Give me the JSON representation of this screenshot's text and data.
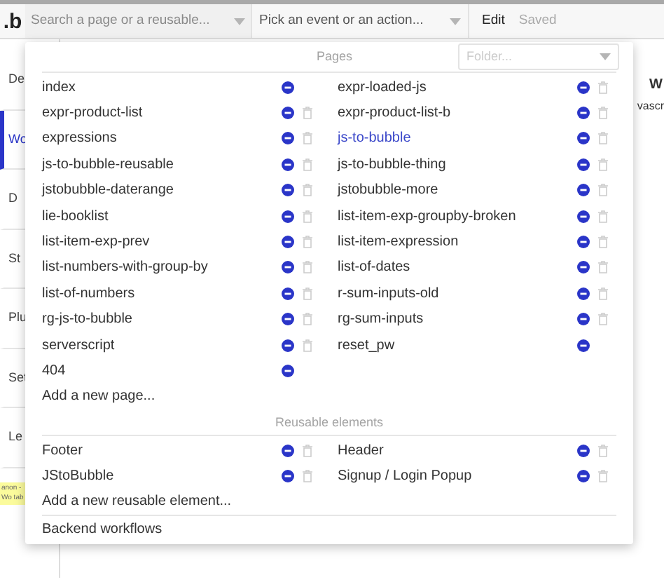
{
  "toolbar": {
    "logo": ".b",
    "page_search": {
      "placeholder": "Search a page or a reusable..."
    },
    "event_picker": {
      "placeholder": "Pick an event or an action..."
    },
    "mode": "Edit",
    "save_status": "Saved"
  },
  "sidebar": {
    "items": [
      {
        "label": "De",
        "selected": false
      },
      {
        "label": "Wo",
        "selected": true
      },
      {
        "label": "D",
        "selected": false
      },
      {
        "label": "St",
        "selected": false
      },
      {
        "label": "Plu",
        "selected": false
      },
      {
        "label": "Set",
        "selected": false
      },
      {
        "label": "Le",
        "selected": false
      }
    ],
    "note": "anon - Wo tab"
  },
  "background": {
    "heading": "W",
    "text": "vascr"
  },
  "dropdown": {
    "pages_heading": "Pages",
    "folder": {
      "placeholder": "Folder..."
    },
    "pages": [
      {
        "name": "index",
        "selected": false,
        "deletable": false
      },
      {
        "name": "expr-loaded-js",
        "selected": false,
        "deletable": true
      },
      {
        "name": "expr-product-list",
        "selected": false,
        "deletable": true
      },
      {
        "name": "expr-product-list-b",
        "selected": false,
        "deletable": true
      },
      {
        "name": "expressions",
        "selected": false,
        "deletable": true
      },
      {
        "name": "js-to-bubble",
        "selected": true,
        "deletable": true
      },
      {
        "name": "js-to-bubble-reusable",
        "selected": false,
        "deletable": true
      },
      {
        "name": "js-to-bubble-thing",
        "selected": false,
        "deletable": true
      },
      {
        "name": "jstobubble-daterange",
        "selected": false,
        "deletable": true
      },
      {
        "name": "jstobubble-more",
        "selected": false,
        "deletable": true
      },
      {
        "name": "lie-booklist",
        "selected": false,
        "deletable": true
      },
      {
        "name": "list-item-exp-groupby-broken",
        "selected": false,
        "deletable": true
      },
      {
        "name": "list-item-exp-prev",
        "selected": false,
        "deletable": true
      },
      {
        "name": "list-item-expression",
        "selected": false,
        "deletable": true
      },
      {
        "name": "list-numbers-with-group-by",
        "selected": false,
        "deletable": true
      },
      {
        "name": "list-of-dates",
        "selected": false,
        "deletable": true
      },
      {
        "name": "list-of-numbers",
        "selected": false,
        "deletable": true
      },
      {
        "name": "r-sum-inputs-old",
        "selected": false,
        "deletable": true
      },
      {
        "name": "rg-js-to-bubble",
        "selected": false,
        "deletable": true
      },
      {
        "name": "rg-sum-inputs",
        "selected": false,
        "deletable": true
      },
      {
        "name": "serverscript",
        "selected": false,
        "deletable": true
      },
      {
        "name": "reset_pw",
        "selected": false,
        "deletable": false
      },
      {
        "name": "404",
        "selected": false,
        "deletable": false
      }
    ],
    "add_page": "Add a new page...",
    "reusables_heading": "Reusable elements",
    "reusables": [
      {
        "name": "Footer",
        "selected": false,
        "deletable": true
      },
      {
        "name": "Header",
        "selected": false,
        "deletable": true
      },
      {
        "name": "JStoBubble",
        "selected": false,
        "deletable": true
      },
      {
        "name": "Signup / Login Popup",
        "selected": false,
        "deletable": true
      }
    ],
    "add_reusable": "Add a new reusable element...",
    "backend": "Backend workflows"
  }
}
